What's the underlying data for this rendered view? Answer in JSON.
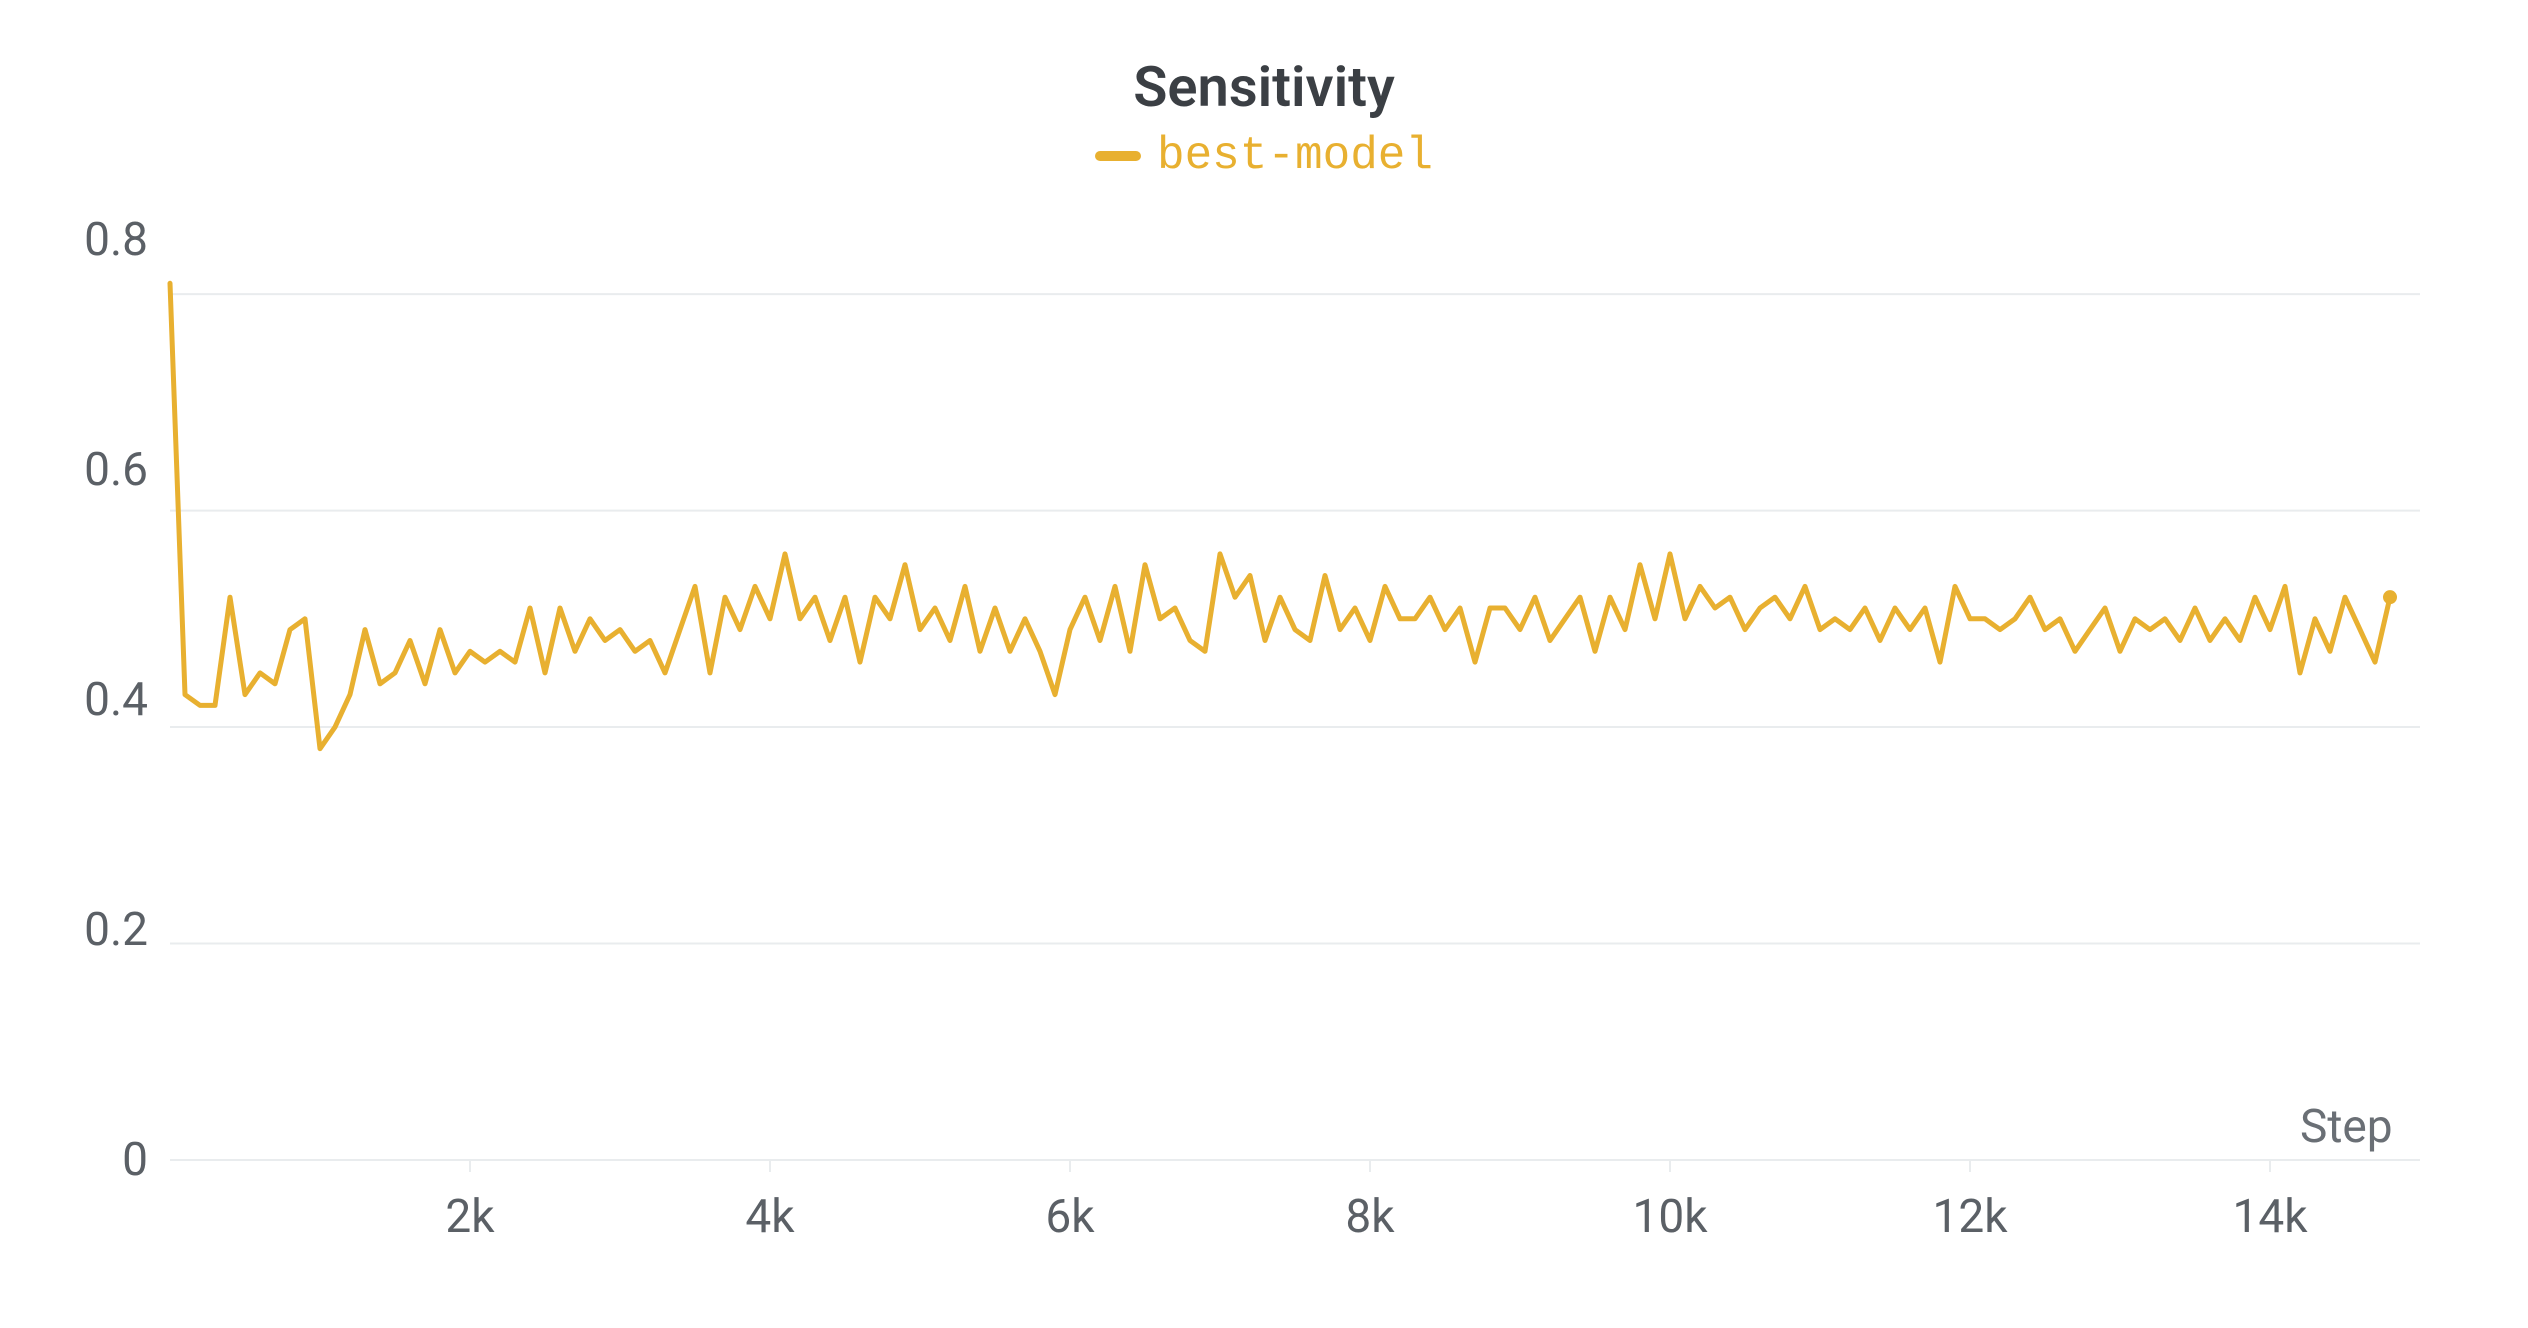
{
  "chart_data": {
    "type": "line",
    "title": "Sensitivity",
    "xlabel": "Step",
    "ylabel": "",
    "xlim": [
      0,
      15000
    ],
    "ylim": [
      0,
      0.85
    ],
    "x_ticks": [
      2000,
      4000,
      6000,
      8000,
      10000,
      12000,
      14000
    ],
    "x_tick_labels": [
      "2k",
      "4k",
      "6k",
      "8k",
      "10k",
      "12k",
      "14k"
    ],
    "y_ticks": [
      0,
      0.2,
      0.4,
      0.6,
      0.8
    ],
    "y_tick_labels": [
      "0",
      "0.2",
      "0.4",
      "0.6",
      "0.8"
    ],
    "legend": {
      "position": "top-center",
      "entries": [
        "best-model"
      ]
    },
    "series": [
      {
        "name": "best-model",
        "color": "#e8b030",
        "x": [
          0,
          100,
          200,
          300,
          400,
          500,
          600,
          700,
          800,
          900,
          1000,
          1100,
          1200,
          1300,
          1400,
          1500,
          1600,
          1700,
          1800,
          1900,
          2000,
          2100,
          2200,
          2300,
          2400,
          2500,
          2600,
          2700,
          2800,
          2900,
          3000,
          3100,
          3200,
          3300,
          3400,
          3500,
          3600,
          3700,
          3800,
          3900,
          4000,
          4100,
          4200,
          4300,
          4400,
          4500,
          4600,
          4700,
          4800,
          4900,
          5000,
          5100,
          5200,
          5300,
          5400,
          5500,
          5600,
          5700,
          5800,
          5900,
          6000,
          6100,
          6200,
          6300,
          6400,
          6500,
          6600,
          6700,
          6800,
          6900,
          7000,
          7100,
          7200,
          7300,
          7400,
          7500,
          7600,
          7700,
          7800,
          7900,
          8000,
          8100,
          8200,
          8300,
          8400,
          8500,
          8600,
          8700,
          8800,
          8900,
          9000,
          9100,
          9200,
          9300,
          9400,
          9500,
          9600,
          9700,
          9800,
          9900,
          10000,
          10100,
          10200,
          10300,
          10400,
          10500,
          10600,
          10700,
          10800,
          10900,
          11000,
          11100,
          11200,
          11300,
          11400,
          11500,
          11600,
          11700,
          11800,
          11900,
          12000,
          12100,
          12200,
          12300,
          12400,
          12500,
          12600,
          12700,
          12800,
          12900,
          13000,
          13100,
          13200,
          13300,
          13400,
          13500,
          13600,
          13700,
          13800,
          13900,
          14000,
          14100,
          14200,
          14300,
          14400,
          14500,
          14600,
          14700,
          14800
        ],
        "values": [
          0.81,
          0.43,
          0.42,
          0.42,
          0.52,
          0.43,
          0.45,
          0.44,
          0.49,
          0.5,
          0.38,
          0.4,
          0.43,
          0.49,
          0.44,
          0.45,
          0.48,
          0.44,
          0.49,
          0.45,
          0.47,
          0.46,
          0.47,
          0.46,
          0.51,
          0.45,
          0.51,
          0.47,
          0.5,
          0.48,
          0.49,
          0.47,
          0.48,
          0.45,
          0.49,
          0.53,
          0.45,
          0.52,
          0.49,
          0.53,
          0.5,
          0.56,
          0.5,
          0.52,
          0.48,
          0.52,
          0.46,
          0.52,
          0.5,
          0.55,
          0.49,
          0.51,
          0.48,
          0.53,
          0.47,
          0.51,
          0.47,
          0.5,
          0.47,
          0.43,
          0.49,
          0.52,
          0.48,
          0.53,
          0.47,
          0.55,
          0.5,
          0.51,
          0.48,
          0.47,
          0.56,
          0.52,
          0.54,
          0.48,
          0.52,
          0.49,
          0.48,
          0.54,
          0.49,
          0.51,
          0.48,
          0.53,
          0.5,
          0.5,
          0.52,
          0.49,
          0.51,
          0.46,
          0.51,
          0.51,
          0.49,
          0.52,
          0.48,
          0.5,
          0.52,
          0.47,
          0.52,
          0.49,
          0.55,
          0.5,
          0.56,
          0.5,
          0.53,
          0.51,
          0.52,
          0.49,
          0.51,
          0.52,
          0.5,
          0.53,
          0.49,
          0.5,
          0.49,
          0.51,
          0.48,
          0.51,
          0.49,
          0.51,
          0.46,
          0.53,
          0.5,
          0.5,
          0.49,
          0.5,
          0.52,
          0.49,
          0.5,
          0.47,
          0.49,
          0.51,
          0.47,
          0.5,
          0.49,
          0.5,
          0.48,
          0.51,
          0.48,
          0.5,
          0.48,
          0.52,
          0.49,
          0.53,
          0.45,
          0.5,
          0.47,
          0.52,
          0.49,
          0.46,
          0.52
        ]
      }
    ]
  }
}
